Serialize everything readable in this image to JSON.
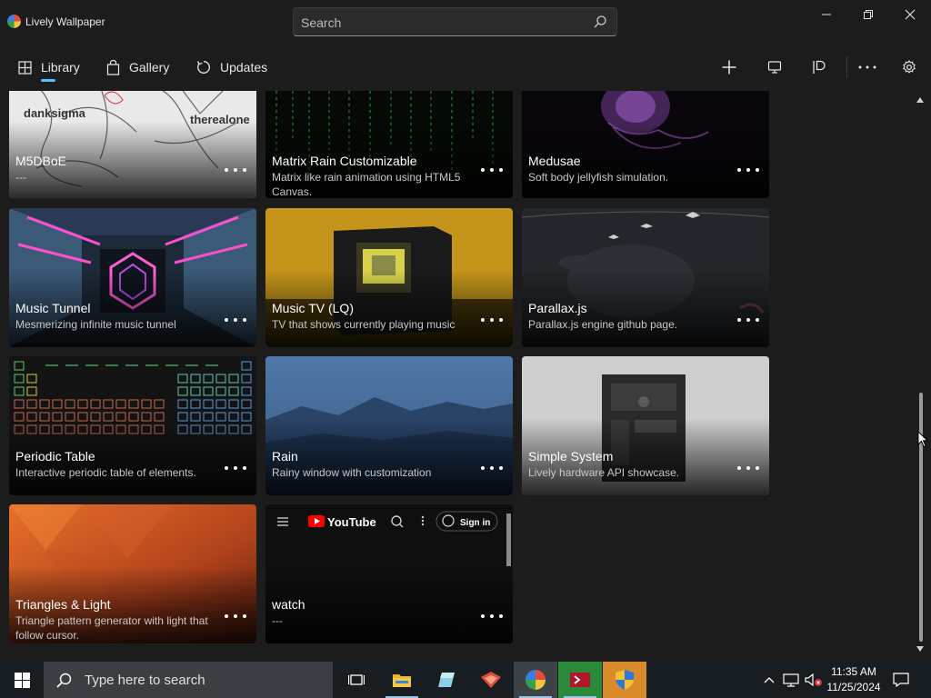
{
  "app": {
    "title": "Lively Wallpaper"
  },
  "search": {
    "placeholder": "Search"
  },
  "nav": {
    "tabs": [
      {
        "label": "Library"
      },
      {
        "label": "Gallery"
      },
      {
        "label": "Updates"
      }
    ]
  },
  "cards": [
    {
      "title": "M5DBoE",
      "desc": "---",
      "art_text_1": "danksigma",
      "art_text_2": "therealone"
    },
    {
      "title": "Matrix Rain Customizable",
      "desc": "Matrix like rain animation using HTML5 Canvas."
    },
    {
      "title": "Medusae",
      "desc": "Soft body jellyfish simulation."
    },
    {
      "title": "Music Tunnel",
      "desc": "Mesmerizing infinite music tunnel"
    },
    {
      "title": "Music TV (LQ)",
      "desc": "TV that shows currently playing music"
    },
    {
      "title": "Parallax.js",
      "desc": "Parallax.js engine github page."
    },
    {
      "title": "Periodic Table",
      "desc": "Interactive periodic table of elements."
    },
    {
      "title": "Rain",
      "desc": "Rainy window with customization"
    },
    {
      "title": "Simple System",
      "desc": "Lively hardware API showcase."
    },
    {
      "title": "Triangles & Light",
      "desc": "Triangle pattern generator with light that follow cursor."
    },
    {
      "title": "watch",
      "desc": "---",
      "preview": {
        "logo": "YouTube",
        "signin": "Sign in"
      }
    }
  ],
  "taskbar": {
    "search_placeholder": "Type here to search",
    "time": "11:35 AM",
    "date": "11/25/2024"
  },
  "colors": {
    "accent": "#4cc2ff",
    "background": "#1c1c1c",
    "taskbar": "#181d22"
  }
}
